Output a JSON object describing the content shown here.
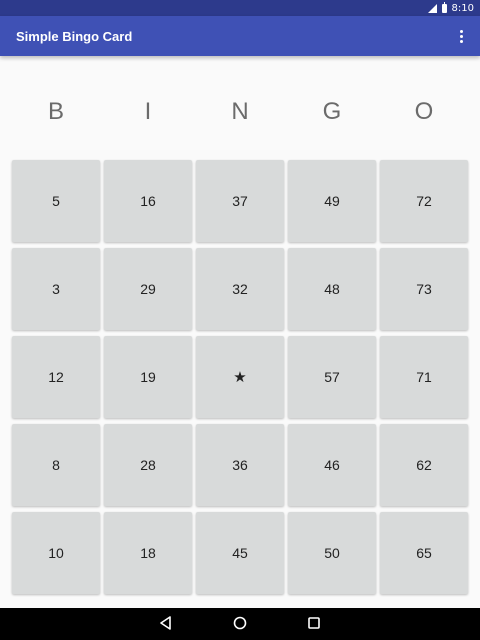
{
  "status_bar": {
    "time": "8:10"
  },
  "app_bar": {
    "title": "Simple Bingo Card",
    "overflow_icon": "more-vert-icon"
  },
  "header": {
    "letters": [
      "B",
      "I",
      "N",
      "G",
      "O"
    ]
  },
  "card": {
    "rows": [
      [
        "5",
        "16",
        "37",
        "49",
        "72"
      ],
      [
        "3",
        "29",
        "32",
        "48",
        "73"
      ],
      [
        "12",
        "19",
        "★",
        "57",
        "71"
      ],
      [
        "8",
        "28",
        "36",
        "46",
        "62"
      ],
      [
        "10",
        "18",
        "45",
        "50",
        "65"
      ]
    ]
  },
  "nav_bar": {
    "icons": [
      "back-icon",
      "home-icon",
      "recents-icon"
    ]
  },
  "colors": {
    "status_bar": "#2d3a8c",
    "app_bar": "#3f51b5",
    "cell_bg": "#d8dada",
    "letter": "#6b6b6b",
    "background": "#fafafa"
  }
}
